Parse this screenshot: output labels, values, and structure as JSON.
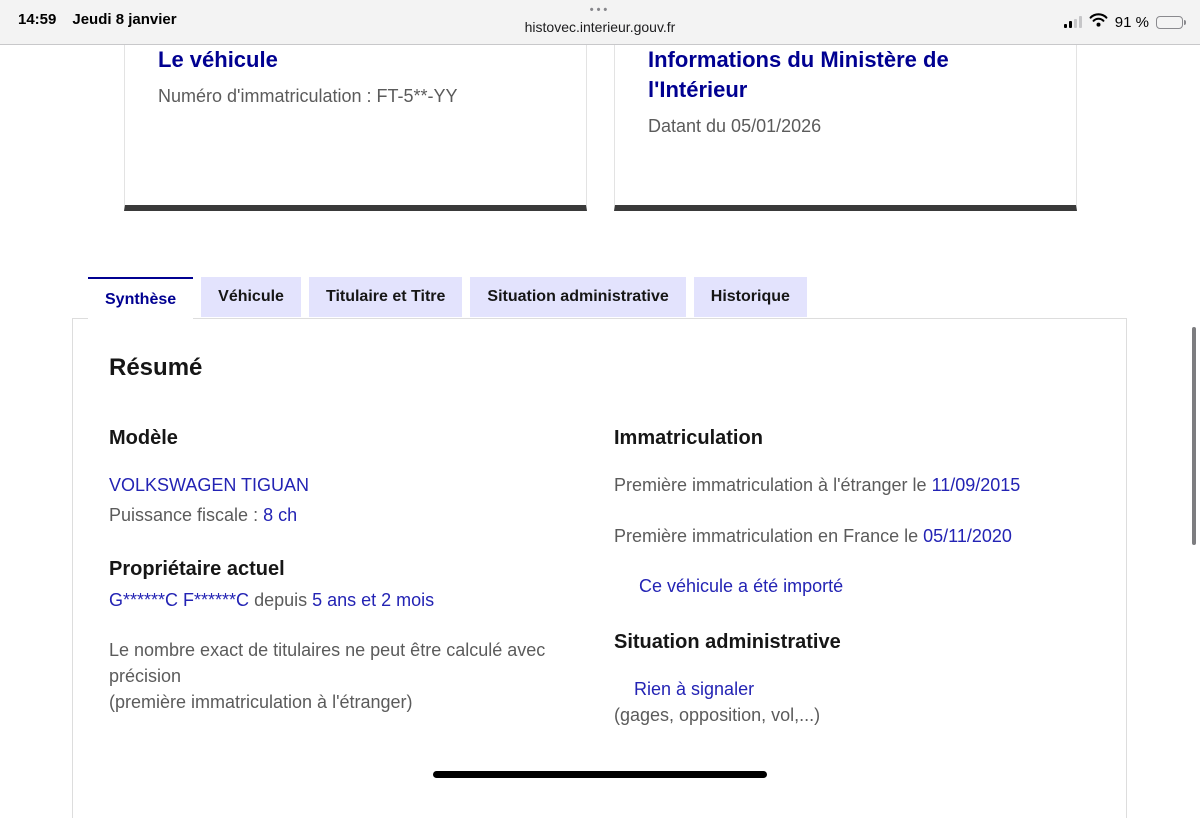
{
  "status_bar": {
    "time": "14:59",
    "date": "Jeudi 8 janvier",
    "menu_dots": "•••",
    "url": "histovec.interieur.gouv.fr",
    "battery_percent": "91 %"
  },
  "cards": {
    "vehicle": {
      "title": "Le véhicule",
      "body": "Numéro d'immatriculation : FT-5**-YY"
    },
    "ministry": {
      "title": "Informations du Ministère de l'Intérieur",
      "body": "Datant du 05/01/2026"
    }
  },
  "tabs": [
    {
      "label": "Synthèse",
      "active": true
    },
    {
      "label": "Véhicule",
      "active": false
    },
    {
      "label": "Titulaire et Titre",
      "active": false
    },
    {
      "label": "Situation administrative",
      "active": false
    },
    {
      "label": "Historique",
      "active": false
    }
  ],
  "panel": {
    "title": "Résumé",
    "model": {
      "heading": "Modèle",
      "name": "VOLKSWAGEN TIGUAN",
      "power_label": "Puissance fiscale : ",
      "power_value": "8 ch"
    },
    "owner": {
      "heading": "Propriétaire actuel",
      "name": "G******C F******C",
      "since_label": " depuis ",
      "since_value": "5 ans et 2 mois",
      "note_line1": "Le nombre exact de titulaires ne peut être calculé avec précision",
      "note_line2": "(première immatriculation à l'étranger)"
    },
    "registration": {
      "heading": "Immatriculation",
      "first_foreign_label": "Première immatriculation à l'étranger le ",
      "first_foreign_date": "11/09/2015",
      "first_france_label": "Première immatriculation en France le ",
      "first_france_date": "05/11/2020",
      "imported_note": "Ce véhicule a été importé"
    },
    "admin_status": {
      "heading": "Situation administrative",
      "status_text": "Rien à signaler",
      "status_note": "(gages, opposition, vol,...)"
    }
  },
  "colors": {
    "primary_blue": "#000091",
    "link_blue": "#2323b4",
    "tab_inactive_bg": "#e3e3fd",
    "card_bottom_border": "#3a3a3a",
    "status_bar_bg": "#f3f3f3"
  }
}
